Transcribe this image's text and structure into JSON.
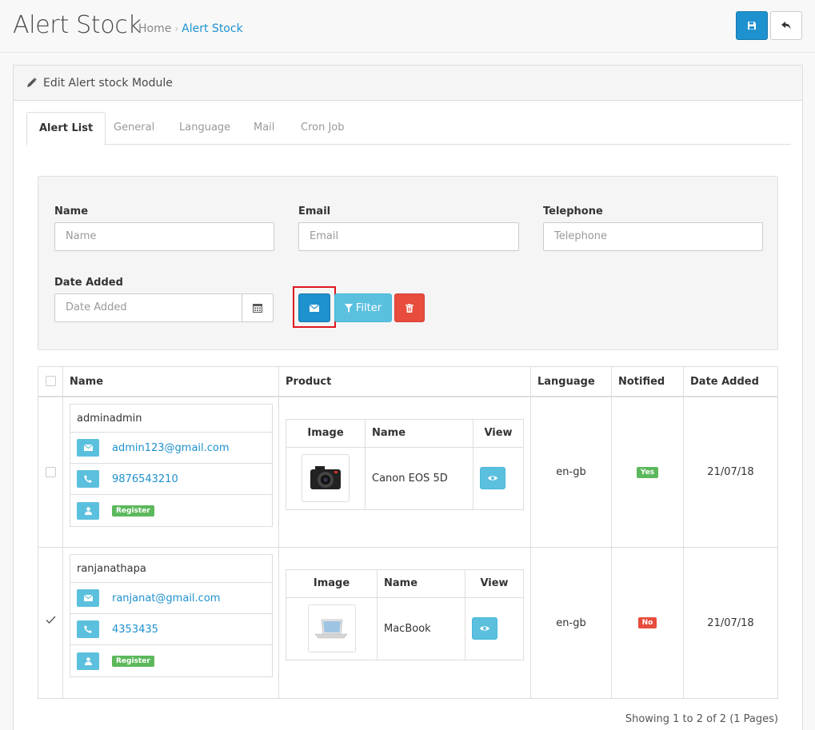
{
  "header": {
    "title": "Alert Stock",
    "breadcrumb": {
      "home": "Home",
      "separator": "›",
      "current": "Alert Stock"
    },
    "save_icon": "floppy-icon",
    "back_icon": "reply-icon"
  },
  "panel": {
    "heading": "Edit Alert stock Module",
    "tabs": [
      "Alert List",
      "General",
      "Language",
      "Mail",
      "Cron Job"
    ]
  },
  "filters": {
    "name": {
      "label": "Name",
      "placeholder": "Name"
    },
    "email": {
      "label": "Email",
      "placeholder": "Email"
    },
    "telephone": {
      "label": "Telephone",
      "placeholder": "Telephone"
    },
    "date_added": {
      "label": "Date Added",
      "placeholder": "Date Added"
    },
    "filter_button": "Filter"
  },
  "table": {
    "headers": [
      "Name",
      "Product",
      "Language",
      "Notified",
      "Date Added"
    ],
    "product_headers": [
      "Image",
      "Name",
      "View"
    ],
    "rows": [
      {
        "username": "adminadmin",
        "email": "admin123@gmail.com",
        "phone": "9876543210",
        "status": "Register",
        "product": "Canon EOS 5D",
        "language": "en-gb",
        "notified": "Yes",
        "date": "21/07/18",
        "checked": false
      },
      {
        "username": "ranjanathapa",
        "email": "ranjanat@gmail.com",
        "phone": "4353435",
        "status": "Register",
        "product": "MacBook",
        "language": "en-gb",
        "notified": "No",
        "date": "21/07/18",
        "checked": true
      }
    ]
  },
  "pagination": "Showing 1 to 2 of 2 (1 Pages)",
  "colors": {
    "primary": "#1e91cf",
    "info": "#5bc0de",
    "danger": "#e74c3c",
    "success": "#5cb85c"
  }
}
